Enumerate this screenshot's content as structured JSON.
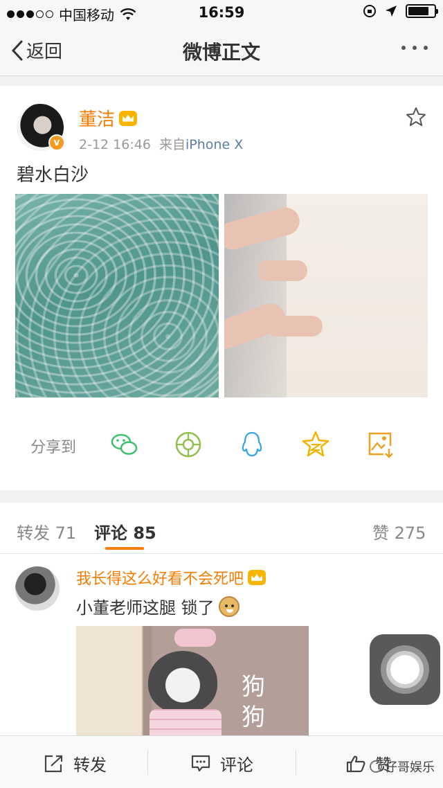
{
  "status_bar": {
    "carrier": "中国移动",
    "time": "16:59",
    "battery_level": 0.8
  },
  "nav": {
    "back_label": "返回",
    "title": "微博正文"
  },
  "post": {
    "author": "董洁",
    "timestamp": "2-12 16:46",
    "source_prefix": "来自",
    "source": "iPhone X",
    "text": "碧水白沙",
    "share_label": "分享到",
    "share_targets": [
      "wechat-icon",
      "moments-icon",
      "qq-icon",
      "qzone-icon",
      "save-image-icon"
    ]
  },
  "comments_tabs": {
    "repost_label": "转发",
    "repost_count": "71",
    "comment_label": "评论",
    "comment_count": "85",
    "like_label": "赞",
    "like_count": "275"
  },
  "comment": {
    "author": "我长得这么好看不会死吧",
    "text": "小董老师这腿 锁了",
    "meme_text": "狗狗"
  },
  "bottom_bar": {
    "repost": "转发",
    "comment": "评论",
    "like": "赞"
  },
  "watermark": "仔哥娱乐",
  "colors": {
    "accent": "#f57c00",
    "link": "#5b7ea8",
    "vip_badge": "#f7b500"
  }
}
